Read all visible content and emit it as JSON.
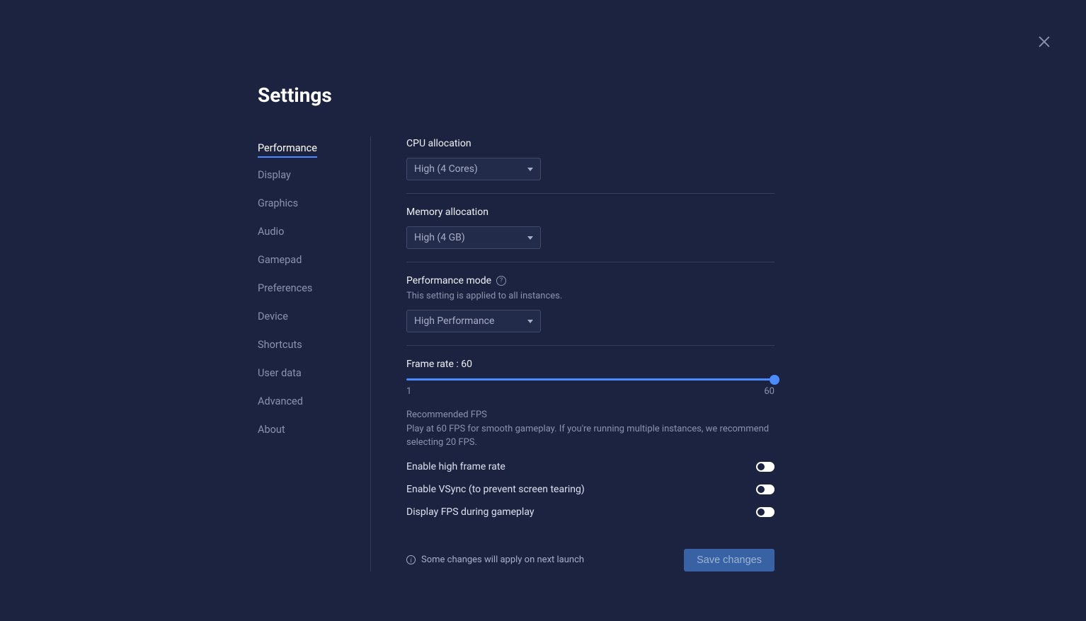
{
  "title": "Settings",
  "sidebar": {
    "items": [
      {
        "label": "Performance",
        "active": true
      },
      {
        "label": "Display",
        "active": false
      },
      {
        "label": "Graphics",
        "active": false
      },
      {
        "label": "Audio",
        "active": false
      },
      {
        "label": "Gamepad",
        "active": false
      },
      {
        "label": "Preferences",
        "active": false
      },
      {
        "label": "Device",
        "active": false
      },
      {
        "label": "Shortcuts",
        "active": false
      },
      {
        "label": "User data",
        "active": false
      },
      {
        "label": "Advanced",
        "active": false
      },
      {
        "label": "About",
        "active": false
      }
    ]
  },
  "cpu": {
    "label": "CPU allocation",
    "value": "High (4 Cores)"
  },
  "memory": {
    "label": "Memory allocation",
    "value": "High (4 GB)"
  },
  "perf_mode": {
    "label": "Performance mode",
    "note": "This setting is applied to all instances.",
    "value": "High Performance"
  },
  "frame_rate": {
    "label": "Frame rate : 60",
    "min": "1",
    "max": "60",
    "hint_title": "Recommended FPS",
    "hint_body": "Play at 60 FPS for smooth gameplay. If you're running multiple instances, we recommend selecting 20 FPS."
  },
  "toggles": {
    "high_frame_rate": "Enable high frame rate",
    "vsync": "Enable VSync (to prevent screen tearing)",
    "display_fps": "Display FPS during gameplay"
  },
  "footer": {
    "note": "Some changes will apply on next launch",
    "save": "Save changes"
  }
}
